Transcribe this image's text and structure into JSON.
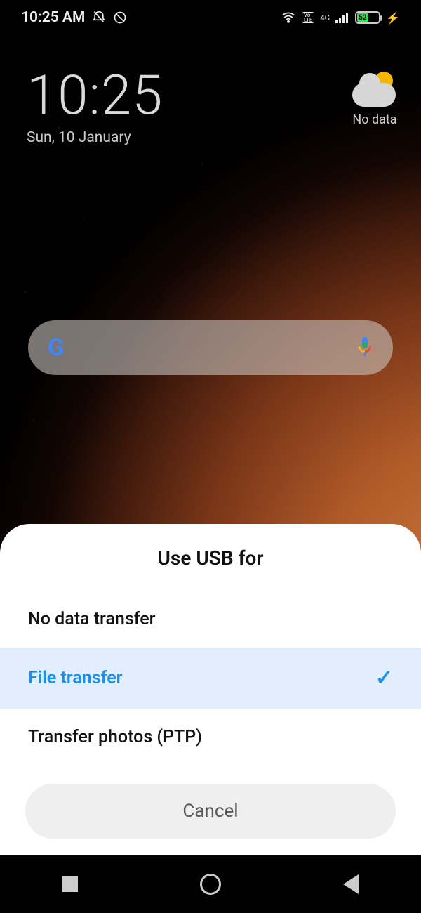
{
  "status": {
    "time": "10:25 AM",
    "volte": "Vo LTE",
    "network": "4G",
    "battery_pct": "52"
  },
  "lock": {
    "time": "10:25",
    "date": "Sun, 10 January"
  },
  "weather": {
    "label": "No data"
  },
  "sheet": {
    "title": "Use USB for",
    "options": [
      {
        "label": "No data transfer",
        "selected": false
      },
      {
        "label": "File transfer",
        "selected": true
      },
      {
        "label": "Transfer photos (PTP)",
        "selected": false
      }
    ],
    "cancel": "Cancel"
  }
}
